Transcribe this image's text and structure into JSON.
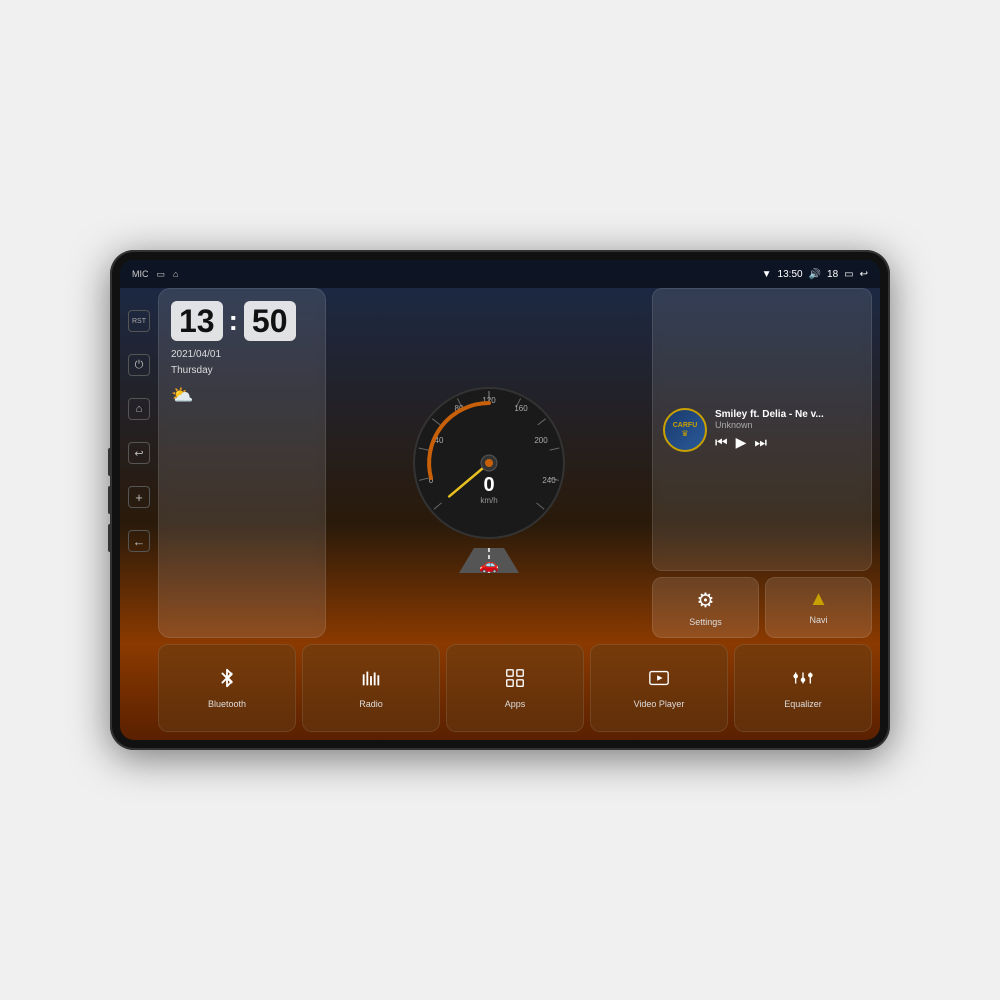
{
  "device": {
    "status_bar": {
      "mic_label": "MIC",
      "home_icon": "⌂",
      "house_icon": "🏠",
      "wifi_icon": "▼",
      "time": "13:50",
      "volume_icon": "🔊",
      "volume_level": "18",
      "battery_icon": "🔋",
      "back_icon": "↩"
    },
    "side_icons": [
      {
        "name": "home-icon",
        "symbol": "⌂"
      },
      {
        "name": "power-icon",
        "symbol": "⏻"
      },
      {
        "name": "back-icon",
        "symbol": "↩"
      },
      {
        "name": "volume-up-icon",
        "symbol": "↑"
      },
      {
        "name": "volume-down-icon",
        "symbol": "←"
      }
    ],
    "clock": {
      "hours": "13",
      "minutes": "50",
      "date": "2021/04/01",
      "day": "Thursday"
    },
    "speedometer": {
      "speed": "0",
      "unit": "km/h",
      "max": "240"
    },
    "music": {
      "logo": "CARFU",
      "title": "Smiley ft. Delia - Ne v...",
      "artist": "Unknown",
      "prev_icon": "⏮",
      "play_icon": "▶",
      "next_icon": "⏭"
    },
    "action_buttons": [
      {
        "name": "settings-button",
        "icon": "⚙",
        "label": "Settings"
      },
      {
        "name": "navi-button",
        "icon": "▲",
        "label": "Navi"
      }
    ],
    "app_buttons": [
      {
        "name": "bluetooth-button",
        "icon": "bluetooth",
        "label": "Bluetooth"
      },
      {
        "name": "radio-button",
        "icon": "radio",
        "label": "Radio"
      },
      {
        "name": "apps-button",
        "icon": "apps",
        "label": "Apps"
      },
      {
        "name": "video-player-button",
        "icon": "video",
        "label": "Video Player"
      },
      {
        "name": "equalizer-button",
        "icon": "equalizer",
        "label": "Equalizer"
      }
    ]
  }
}
